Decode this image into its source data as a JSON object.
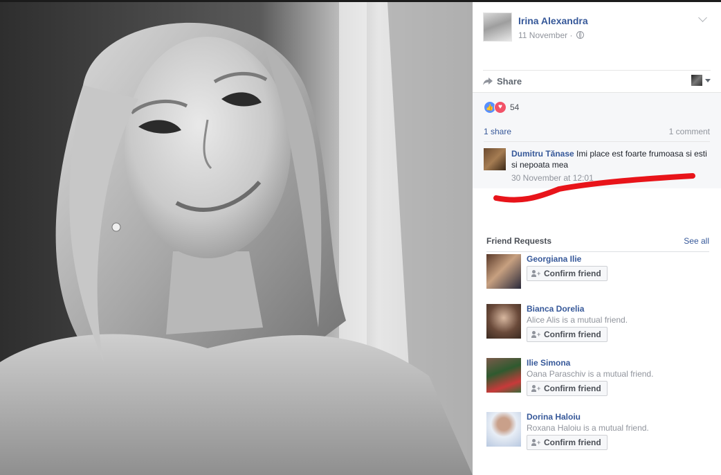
{
  "post": {
    "author": "Irina Alexandra",
    "date": "11 November",
    "separator": "·",
    "share_label": "Share"
  },
  "feedback": {
    "reaction_count": "54",
    "shares": "1 share",
    "comments": "1 comment",
    "comment": {
      "author": "Dumitru Tănase",
      "text": "Imi place est foarte frumoasa si esti si nepoata mea",
      "time": "30 November at 12:01"
    }
  },
  "friend_requests": {
    "title": "Friend Requests",
    "see_all": "See all",
    "confirm_label": "Confirm friend",
    "items": [
      {
        "name": "Georgiana Ilie",
        "mutual": ""
      },
      {
        "name": "Bianca Dorelia",
        "mutual": "Alice Alis is a mutual friend."
      },
      {
        "name": "Ilie Simona",
        "mutual": "Oana Paraschiv is a mutual friend."
      },
      {
        "name": "Dorina Haloiu",
        "mutual": "Roxana Haloiu is a mutual friend."
      }
    ]
  },
  "colors": {
    "link": "#365899",
    "muted": "#90949c",
    "like": "#5890ff",
    "love": "#f25268",
    "annotation": "#e8141a"
  }
}
